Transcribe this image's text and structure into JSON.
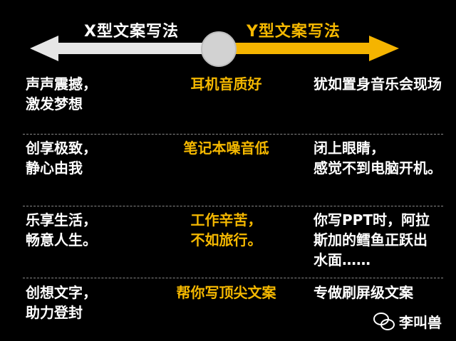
{
  "header": {
    "x_label": "X型文案写法",
    "y_label": "Y型文案写法"
  },
  "rows": [
    {
      "left": [
        "声声震撼，",
        "激发梦想"
      ],
      "mid": [
        "耳机音质好"
      ],
      "right": [
        "犹如置身音乐会现场"
      ]
    },
    {
      "left": [
        "创享极致，",
        "静心由我"
      ],
      "mid": [
        "笔记本噪音低"
      ],
      "right": [
        "闭上眼睛，",
        "感觉不到电脑开机。"
      ]
    },
    {
      "left": [
        "乐享生活，",
        "畅意人生。"
      ],
      "mid": [
        "工作辛苦，",
        "不如旅行。"
      ],
      "right": [
        "你写PPT时，阿拉",
        "斯加的鳕鱼正跃出",
        "水面……"
      ]
    },
    {
      "left": [
        "创想文字，",
        "助力登封"
      ],
      "mid": [
        "帮你写顶尖文案"
      ],
      "right": [
        "专做刷屏级文案"
      ]
    }
  ],
  "footer": {
    "author": "李叫兽",
    "icon": "wechat-icon"
  },
  "colors": {
    "accent": "#f5b800",
    "background": "#000000",
    "left_arrow": "#e6e6e6"
  }
}
